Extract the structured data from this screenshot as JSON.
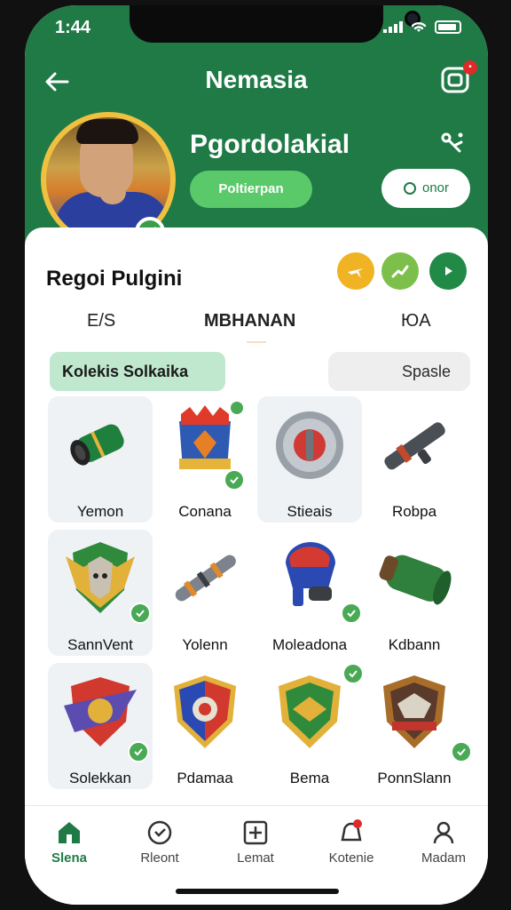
{
  "status_bar": {
    "time": "1:44"
  },
  "header": {
    "title": "Nemasia",
    "username": "Pgordolakial",
    "pill_primary": "Poltierpan",
    "pill_secondary": "onor"
  },
  "profile": {
    "subtitle": "Regoi Pulgini"
  },
  "tabs": [
    {
      "label": "E/S"
    },
    {
      "label": "MBHANAN"
    },
    {
      "label": "ЮA"
    }
  ],
  "filters": {
    "left": "Kolekis Solkaika",
    "right": "Spasle"
  },
  "items": [
    {
      "label": "Yemon"
    },
    {
      "label": "Conana"
    },
    {
      "label": "Stieais"
    },
    {
      "label": "Robpa"
    },
    {
      "label": "SannVent"
    },
    {
      "label": "Yolenn"
    },
    {
      "label": "Moleadona"
    },
    {
      "label": "Kdbann"
    },
    {
      "label": "Solekkan"
    },
    {
      "label": "Pdamaa"
    },
    {
      "label": "Bema"
    },
    {
      "label": "PonnSlann"
    }
  ],
  "bottom_nav": [
    {
      "label": "Slena",
      "active": true
    },
    {
      "label": "Rleont",
      "active": false
    },
    {
      "label": "Lemat",
      "active": false
    },
    {
      "label": "Kotenie",
      "active": false
    },
    {
      "label": "Madam",
      "active": false
    }
  ],
  "colors": {
    "header_green": "#1f7a46",
    "pill_green": "#5ac96a",
    "accent_gold": "#f0c040",
    "danger_red": "#e02a2a",
    "check_green": "#4aa955"
  },
  "icons": {
    "back": "arrow-left-icon",
    "top_right": "camera-badge-icon",
    "share": "share-icon",
    "chat": "chat-icon",
    "action_1": "plane-icon",
    "action_2": "chart-icon",
    "action_3": "play-icon",
    "nav_home": "home-icon",
    "nav_clock": "clock-icon",
    "nav_add": "add-box-icon",
    "nav_bell": "bell-icon",
    "nav_user": "user-icon"
  }
}
